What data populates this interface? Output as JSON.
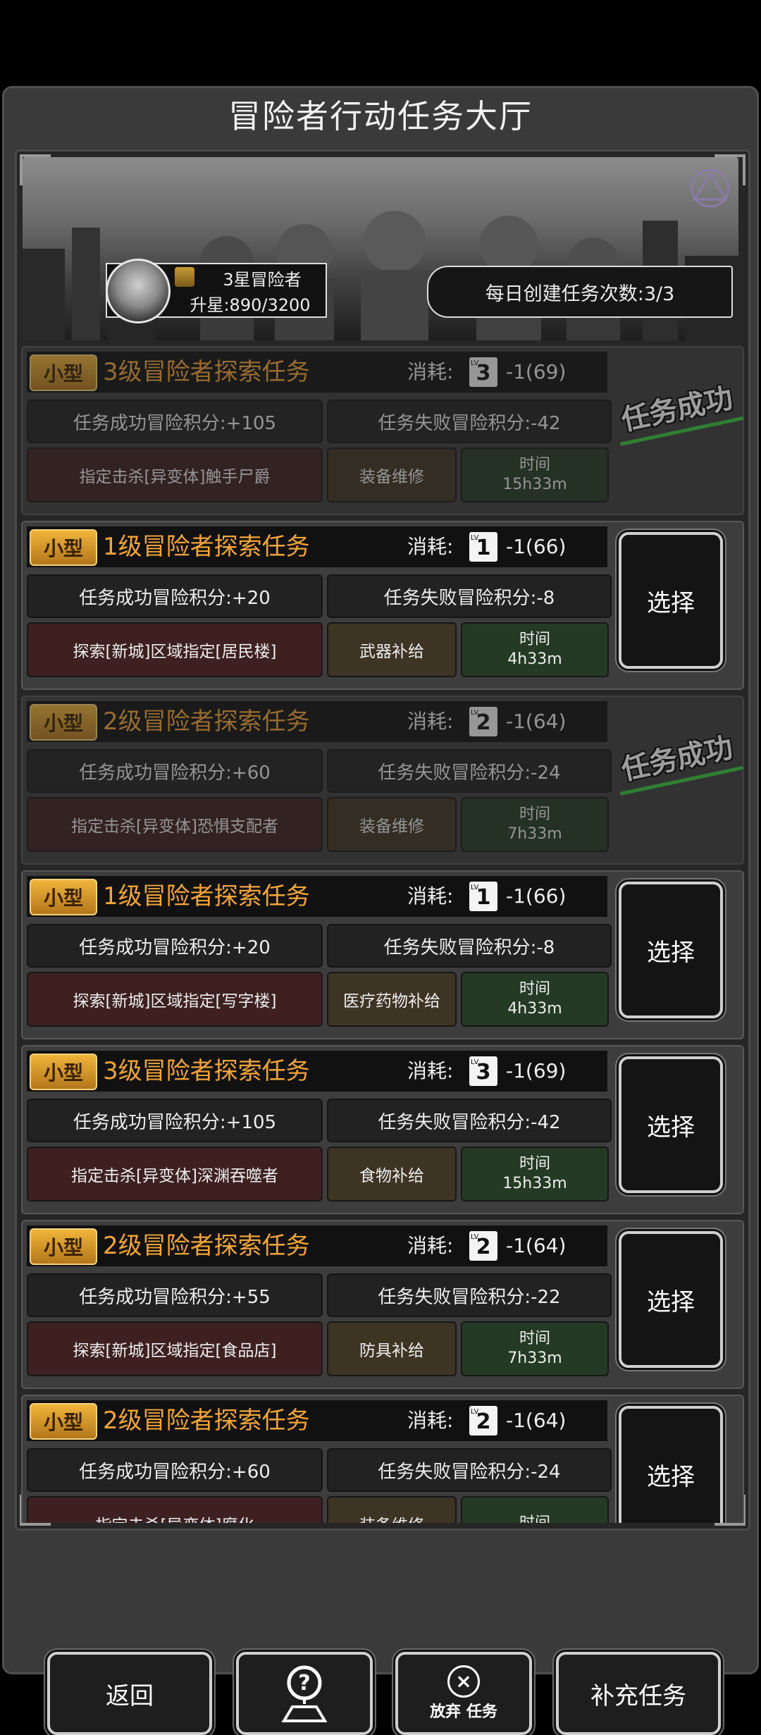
{
  "title": "冒险者行动任务大厅",
  "player": {
    "rank_name": "3星冒险者",
    "upgrade": "升星:890/3200",
    "daily_tasks": "每日创建任务次数:3/3"
  },
  "labels": {
    "cost": "消耗:",
    "time": "时间",
    "select": "选择",
    "success_stamp": "任务成功"
  },
  "tasks": [
    {
      "size": "小型",
      "title": "3级冒险者探索任务",
      "cost_level": "3",
      "cost_value": "-1(69)",
      "success_score": "任务成功冒险积分:+105",
      "fail_score": "任务失败冒险积分:-42",
      "objective": "指定击杀[异变体]触手尸爵",
      "reward": "装备维修",
      "time": "15h33m",
      "status": "done"
    },
    {
      "size": "小型",
      "title": "1级冒险者探索任务",
      "cost_level": "1",
      "cost_value": "-1(66)",
      "success_score": "任务成功冒险积分:+20",
      "fail_score": "任务失败冒险积分:-8",
      "objective": "探索[新城]区域指定[居民楼]",
      "reward": "武器补给",
      "time": "4h33m",
      "status": "available"
    },
    {
      "size": "小型",
      "title": "2级冒险者探索任务",
      "cost_level": "2",
      "cost_value": "-1(64)",
      "success_score": "任务成功冒险积分:+60",
      "fail_score": "任务失败冒险积分:-24",
      "objective": "指定击杀[异变体]恐惧支配者",
      "reward": "装备维修",
      "time": "7h33m",
      "status": "done"
    },
    {
      "size": "小型",
      "title": "1级冒险者探索任务",
      "cost_level": "1",
      "cost_value": "-1(66)",
      "success_score": "任务成功冒险积分:+20",
      "fail_score": "任务失败冒险积分:-8",
      "objective": "探索[新城]区域指定[写字楼]",
      "reward": "医疗药物补给",
      "time": "4h33m",
      "status": "available"
    },
    {
      "size": "小型",
      "title": "3级冒险者探索任务",
      "cost_level": "3",
      "cost_value": "-1(69)",
      "success_score": "任务成功冒险积分:+105",
      "fail_score": "任务失败冒险积分:-42",
      "objective": "指定击杀[异变体]深渊吞噬者",
      "reward": "食物补给",
      "time": "15h33m",
      "status": "available"
    },
    {
      "size": "小型",
      "title": "2级冒险者探索任务",
      "cost_level": "2",
      "cost_value": "-1(64)",
      "success_score": "任务成功冒险积分:+55",
      "fail_score": "任务失败冒险积分:-22",
      "objective": "探索[新城]区域指定[食品店]",
      "reward": "防具补给",
      "time": "7h33m",
      "status": "available"
    },
    {
      "size": "小型",
      "title": "2级冒险者探索任务",
      "cost_level": "2",
      "cost_value": "-1(64)",
      "success_score": "任务成功冒险积分:+60",
      "fail_score": "任务失败冒险积分:-24",
      "objective": "指定击杀[异变体]腐化",
      "reward": "装备维修",
      "time": "",
      "status": "available"
    }
  ],
  "bottom": {
    "back": "返回",
    "abandon": "放弃 任务",
    "refill": "补充任务"
  }
}
